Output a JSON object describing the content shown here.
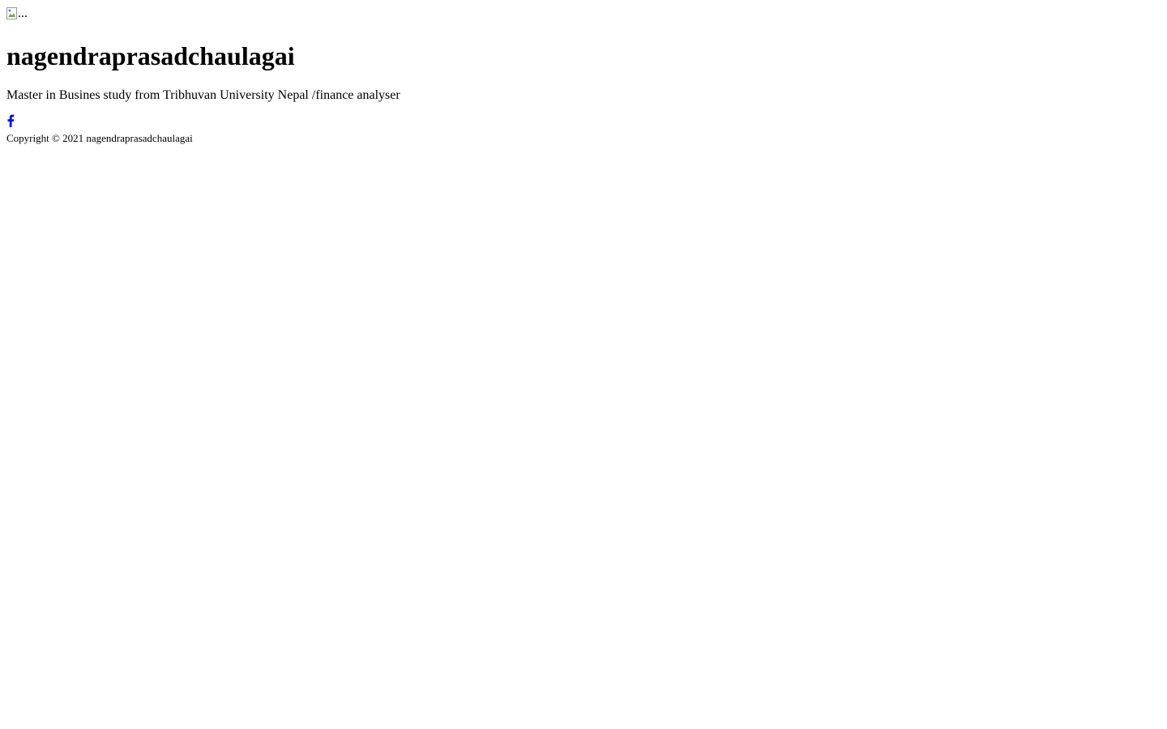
{
  "avatar": {
    "alt": "..."
  },
  "profile": {
    "name": "nagendraprasadchaulagai",
    "bio": "Master in Busines study from Tribhuvan University Nepal /finance analyser"
  },
  "social": {
    "links": [
      {
        "icon": "facebook-icon",
        "color": "#0000ee"
      }
    ]
  },
  "footer": {
    "copyright": "Copyright © 2021 nagendraprasadchaulagai"
  }
}
